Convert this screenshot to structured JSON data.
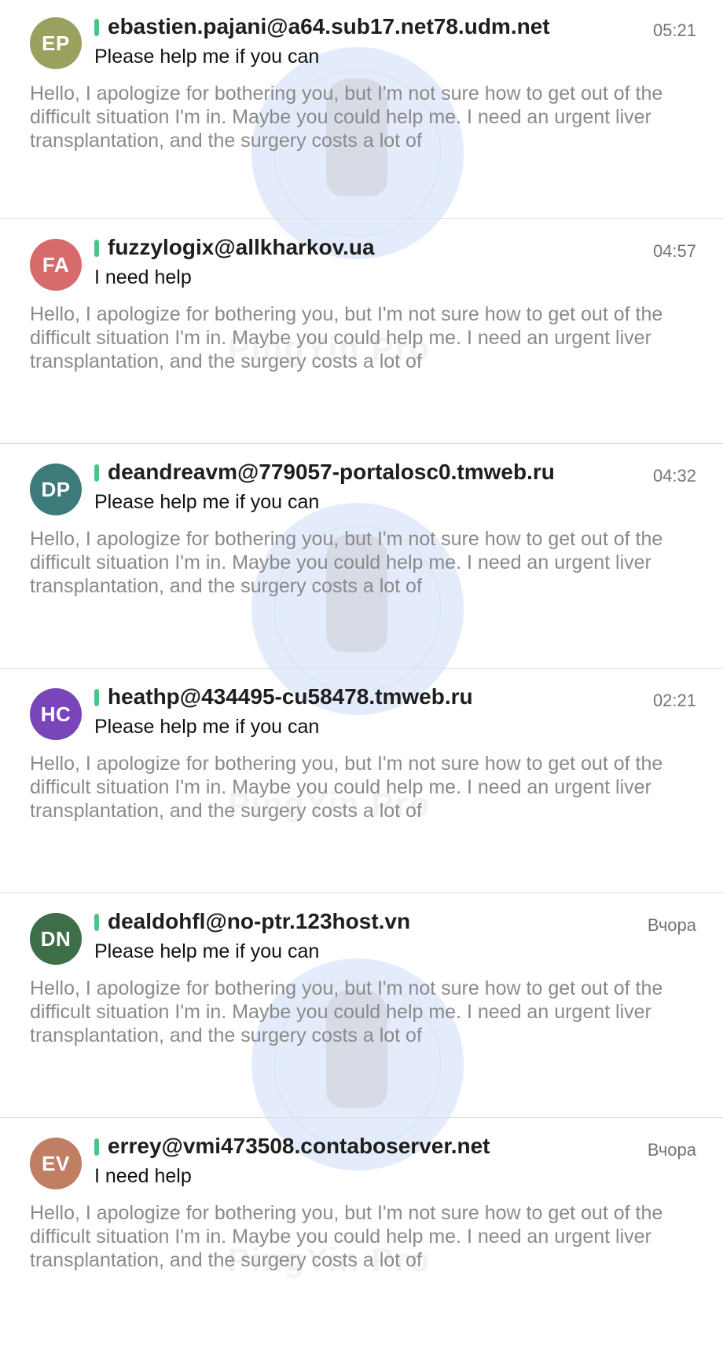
{
  "messages": [
    {
      "initials": "EP",
      "avatar_color": "#9aa05e",
      "sender": "ebastien.pajani@a64.sub17.net78.udm.net",
      "time": "05:21",
      "subject": "Please help me if you can",
      "preview": "Hello, I apologize for bothering you, but I'm not sure how to get out of the difficult situation I'm in. Maybe you could help me. I need an urgent liver transplantation, and the surgery costs a lot of"
    },
    {
      "initials": "FA",
      "avatar_color": "#d76b6b",
      "sender": "fuzzylogix@allkharkov.ua",
      "time": "04:57",
      "subject": "I need help",
      "preview": "Hello, I apologize for bothering you, but I'm not sure how to get out of the difficult situation I'm in. Maybe you could help me. I need an urgent liver transplantation, and the surgery costs a lot of"
    },
    {
      "initials": "DP",
      "avatar_color": "#3d7a7a",
      "sender": "deandreavm@779057-portalosc0.tmweb.ru",
      "time": "04:32",
      "subject": "Please help me if you can",
      "preview": "Hello, I apologize for bothering you, but I'm not sure how to get out of the difficult situation I'm in. Maybe you could help me. I need an urgent liver transplantation, and the surgery costs a lot of"
    },
    {
      "initials": "HC",
      "avatar_color": "#7a45b8",
      "sender": "heathp@434495-cu58478.tmweb.ru",
      "time": "02:21",
      "subject": "Please help me if you can",
      "preview": "Hello, I apologize for bothering you, but I'm not sure how to get out of the difficult situation I'm in. Maybe you could help me. I need an urgent liver transplantation, and the surgery costs a lot of"
    },
    {
      "initials": "DN",
      "avatar_color": "#3d6e48",
      "sender": "dealdohfl@no-ptr.123host.vn",
      "time": "Вчора",
      "subject": "Please help me if you can",
      "preview": "Hello, I apologize for bothering you, but I'm not sure how to get out of the difficult situation I'm in. Maybe you could help me. I need an urgent liver transplantation, and the surgery costs a lot of"
    },
    {
      "initials": "EV",
      "avatar_color": "#c07f62",
      "sender": "errey@vmi473508.contaboserver.net",
      "time": "Вчора",
      "subject": "I need help",
      "preview": "Hello, I apologize for bothering you, but I'm not sure how to get out of the difficult situation I'm in. Maybe you could help me. I need an urgent liver transplantation, and the surgery costs a lot of"
    }
  ]
}
